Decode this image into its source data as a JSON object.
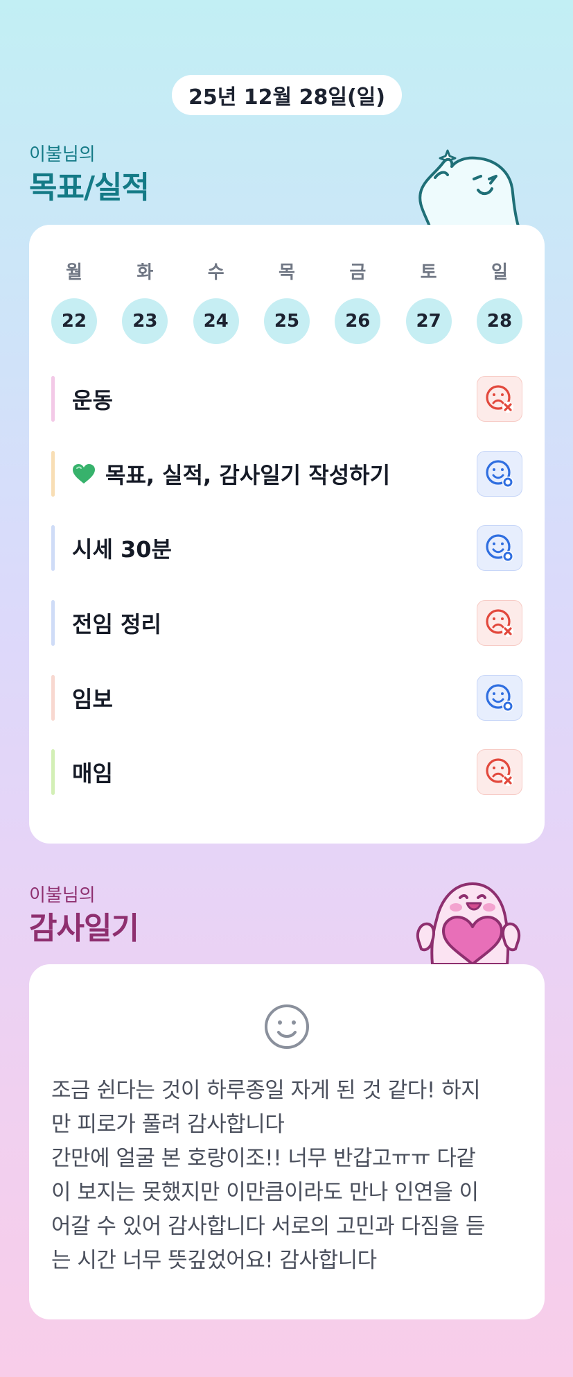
{
  "header": {
    "date": "25년 12월 28일(일)"
  },
  "goals_section": {
    "subtitle": "이불님의",
    "title": "목표/실적",
    "weekdays": [
      "월",
      "화",
      "수",
      "목",
      "금",
      "토",
      "일"
    ],
    "dates": [
      "22",
      "23",
      "24",
      "25",
      "26",
      "27",
      "28"
    ],
    "goals": [
      {
        "label": "운동",
        "bar_color": "#f3c9e7",
        "status": "fail",
        "status_icon": "sad-x-icon"
      },
      {
        "label": "목표, 실적, 감사일기 작성하기",
        "bar_color": "#f8deb5",
        "status": "ok",
        "status_icon": "smile-o-icon",
        "prefix_icon": "green-heart-icon"
      },
      {
        "label": "시세 30분",
        "bar_color": "#cfdcf7",
        "status": "ok",
        "status_icon": "smile-o-icon"
      },
      {
        "label": "전임 정리",
        "bar_color": "#cfdcf7",
        "status": "fail",
        "status_icon": "sad-x-icon"
      },
      {
        "label": "임보",
        "bar_color": "#f8d8d0",
        "status": "ok",
        "status_icon": "smile-o-icon"
      },
      {
        "label": "매임",
        "bar_color": "#d3efb6",
        "status": "fail",
        "status_icon": "sad-x-icon"
      }
    ]
  },
  "diary_section": {
    "subtitle": "이불님의",
    "title": "감사일기",
    "mood_icon": "smiley-face-icon",
    "text": "조금 쉰다는 것이 하루종일 자게 된 것 같다! 하지\n만 피로가 풀려 감사합니다\n간만에 얼굴 본 호랑이조!! 너무 반갑고ㅠㅠ 다같\n이 보지는 못했지만 이만큼이라도 만나 인연을 이\n어갈 수 있어 감사합니다 서로의 고민과 다짐을 듣\n는 시간 너무 뜻깊었어요! 감사합니다"
  },
  "colors": {
    "teal": "#147a86",
    "plum": "#8e2f6f",
    "day_circle": "#c6eef3",
    "fail_red": "#e2483c",
    "ok_blue": "#2f6ee0"
  }
}
